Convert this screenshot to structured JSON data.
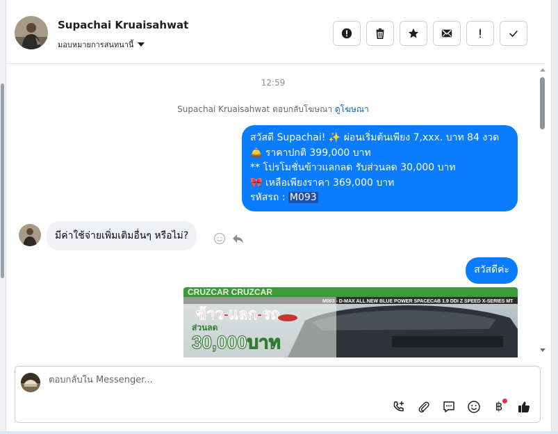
{
  "header": {
    "contact_name": "Supachai Kruaisahwat",
    "assign_label": "มอบหมายการสนทนานี้",
    "actions": [
      "spam",
      "delete",
      "star",
      "mark-unread",
      "follow-up",
      "done"
    ]
  },
  "chat": {
    "timestamp": "12:59",
    "system_message": {
      "text": "Supachai Kruaisahwat ตอบกลับโฆษณา ",
      "link": "ดูโฆษณา"
    },
    "outgoing_1": {
      "line1": "สวัสดี Supachai! ✨  ผ่อนเริ่มต้นเพียง 7,xxx. บาท 84 งวด",
      "line2": "🛎️ ราคาปกติ 399,000 บาท",
      "line3": "** โปรโมชั่นข้าวแลกลด รับส่วนลด 30,000 บาท",
      "line4": "🎀  เหลือเพียงราคา 369,000 บาท",
      "line5_prefix": " รหัสรถ : ",
      "line5_code": "M093"
    },
    "incoming_1": "มีค่าใช้จ่ายเพิ่มเติมอื่นๆ หรือไม่?",
    "outgoing_2": "สวัสดีค่ะ",
    "ad_image": {
      "banner_top": "CRUZCAR CRUZCAR",
      "model_text": "M093 - D-MAX ALL NEW BLUE POWER SPACECAB 1.9 DDI Z SPEED X-SERIES MT",
      "promo_title": "ข้าว-แลก-รถ",
      "promo_sub": "ส่วนลด",
      "promo_amount": "30,000บาท"
    }
  },
  "composer": {
    "placeholder": "ตอบกลับใน Messenger...",
    "tools": [
      "call-add",
      "attachment",
      "saved-reply",
      "emoji",
      "payment",
      "like"
    ],
    "payment_symbol": "฿"
  }
}
